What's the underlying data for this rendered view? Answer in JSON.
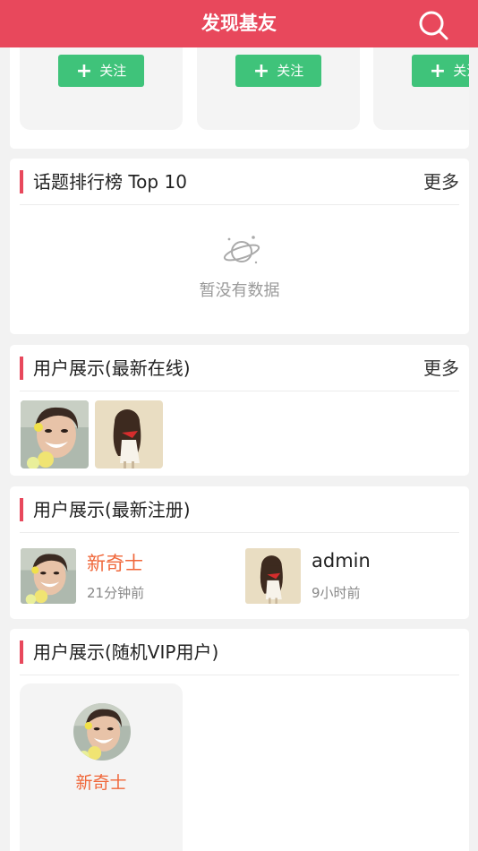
{
  "header": {
    "title": "发现基友",
    "search_icon": "search-icon"
  },
  "follow_section": {
    "buttons": [
      "关注",
      "关注",
      "关注"
    ]
  },
  "topic_rank": {
    "title": "话题排行榜 Top 10",
    "more": "更多",
    "empty_text": "暂没有数据",
    "empty_icon": "planet-icon"
  },
  "online_users": {
    "title": "用户展示(最新在线)",
    "more": "更多"
  },
  "new_users": {
    "title": "用户展示(最新注册)",
    "users": [
      {
        "name": "新奇士",
        "time": "21分钟前",
        "name_color": "#f0673a"
      },
      {
        "name": "admin",
        "time": "9小时前",
        "name_color": "#222222"
      }
    ]
  },
  "vip_users": {
    "title": "用户展示(随机VIP用户)",
    "users": [
      {
        "name": "新奇士"
      }
    ]
  },
  "colors": {
    "brand": "#e8485c",
    "follow": "#3fc37a",
    "highlight": "#f0673a"
  }
}
